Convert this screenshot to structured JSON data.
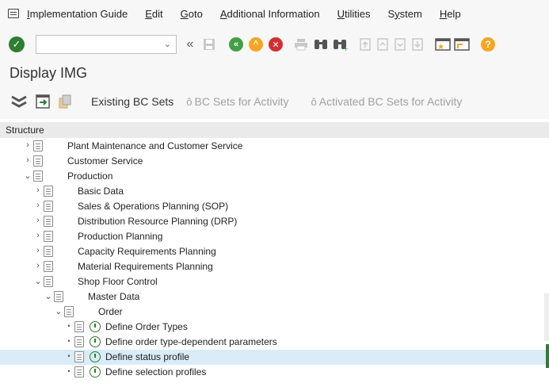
{
  "menu": {
    "items": [
      {
        "pre": "",
        "u": "I",
        "post": "mplementation Guide"
      },
      {
        "pre": "",
        "u": "E",
        "post": "dit"
      },
      {
        "pre": "",
        "u": "G",
        "post": "oto"
      },
      {
        "pre": "",
        "u": "A",
        "post": "dditional Information"
      },
      {
        "pre": "",
        "u": "U",
        "post": "tilities"
      },
      {
        "pre": "S",
        "u": "y",
        "post": "stem"
      },
      {
        "pre": "",
        "u": "H",
        "post": "elp"
      }
    ]
  },
  "toolbar": {
    "command_value": "",
    "icons": [
      "ok-icon",
      "back-double-icon",
      "save-icon",
      "back-icon",
      "exit-icon",
      "cancel-icon",
      "print-icon",
      "find-icon",
      "find-next-icon",
      "first-page-icon",
      "previous-page-icon",
      "next-page-icon",
      "last-page-icon",
      "new-session-icon",
      "shortcut-icon",
      "help-icon"
    ],
    "colors": {
      "ok": "#2e7d32",
      "back": "#43a047",
      "exit": "#f5a623",
      "cancel": "#d32f2f",
      "help": "#f5a623"
    }
  },
  "page": {
    "title": "Display IMG"
  },
  "app_toolbar": {
    "existing_bc_sets": "Existing BC Sets",
    "bc_sets_for_activity": "BC Sets for Activity",
    "activated_bc_sets": "Activated BC Sets for Activity"
  },
  "tree": {
    "header": "Structure",
    "rows": [
      {
        "label": "Plant Maintenance and Customer Service",
        "state": "collapsed",
        "level": 0,
        "activity": false,
        "selected": false
      },
      {
        "label": "Customer Service",
        "state": "collapsed",
        "level": 0,
        "activity": false,
        "selected": false
      },
      {
        "label": "Production",
        "state": "expanded",
        "level": 0,
        "activity": false,
        "selected": false
      },
      {
        "label": "Basic Data",
        "state": "collapsed",
        "level": 1,
        "activity": false,
        "selected": false
      },
      {
        "label": "Sales & Operations Planning (SOP)",
        "state": "collapsed",
        "level": 1,
        "activity": false,
        "selected": false
      },
      {
        "label": "Distribution Resource Planning (DRP)",
        "state": "collapsed",
        "level": 1,
        "activity": false,
        "selected": false
      },
      {
        "label": "Production Planning",
        "state": "collapsed",
        "level": 1,
        "activity": false,
        "selected": false
      },
      {
        "label": "Capacity Requirements Planning",
        "state": "collapsed",
        "level": 1,
        "activity": false,
        "selected": false
      },
      {
        "label": "Material Requirements Planning",
        "state": "collapsed",
        "level": 1,
        "activity": false,
        "selected": false
      },
      {
        "label": "Shop Floor Control",
        "state": "expanded",
        "level": 1,
        "activity": false,
        "selected": false
      },
      {
        "label": "Master Data",
        "state": "expanded",
        "level": 2,
        "activity": false,
        "selected": false
      },
      {
        "label": "Order",
        "state": "expanded",
        "level": 3,
        "activity": false,
        "selected": false
      },
      {
        "label": "Define Order Types",
        "state": "leaf",
        "level": 4,
        "activity": true,
        "selected": false
      },
      {
        "label": "Define order type-dependent parameters",
        "state": "leaf",
        "level": 4,
        "activity": true,
        "selected": false
      },
      {
        "label": "Define status profile",
        "state": "leaf",
        "level": 4,
        "activity": true,
        "selected": true
      },
      {
        "label": "Define selection profiles",
        "state": "leaf",
        "level": 4,
        "activity": true,
        "selected": false
      }
    ]
  }
}
